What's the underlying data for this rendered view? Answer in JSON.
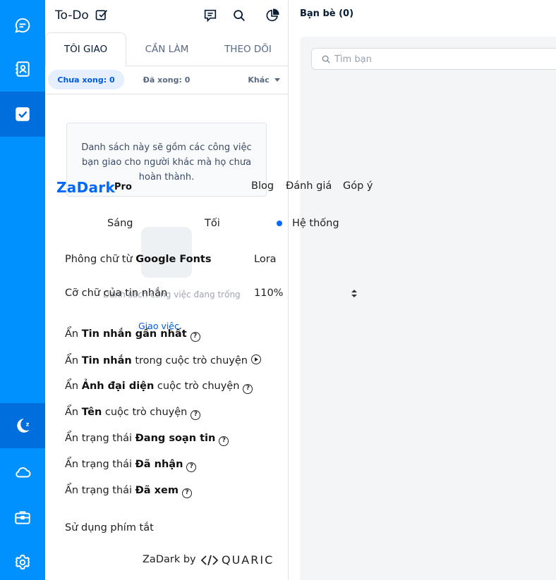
{
  "rail": {
    "top_icons": [
      "chat-icon",
      "contacts-icon",
      "todo-icon"
    ],
    "bottom_icons": [
      "zadark-icon",
      "cloud-icon",
      "briefcase-icon",
      "settings-icon"
    ],
    "accent": "#0091ff",
    "active_bg": "#006edc"
  },
  "todo": {
    "title": "To-Do",
    "tabs": [
      "TÔI GIAO",
      "CẦN LÀM",
      "THEO DÕI"
    ],
    "filters": [
      "Chưa xong: 0",
      "Đã xong: 0",
      "Khác"
    ],
    "empty_message": "Danh sách này sẽ gồm các công việc bạn giao cho người khác mà họ chưa hoàn thành.",
    "ghost_text": "Danh sách công việc đang trống",
    "ghost_link": "Giao việc"
  },
  "friends": {
    "title": "Bạn bè (0)",
    "search_placeholder": "Tìm bạn"
  },
  "zadark": {
    "brand": "ZaDark",
    "badge": "Pro",
    "nav": [
      "Blog",
      "Đánh giá",
      "Góp ý"
    ],
    "themes": [
      "Sáng",
      "Tối",
      "Hệ thống"
    ],
    "selected_theme": "Hệ thống",
    "font_label_prefix": "Phông chữ từ ",
    "font_label_strong": "Google Fonts",
    "font_value": "Lora",
    "size_label": "Cỡ chữ của tin nhắn",
    "size_value": "110%",
    "options": [
      {
        "prefix": "Ẩn ",
        "strong": "Tin nhắn gần nhất",
        "suffix": "",
        "icon": "help-icon"
      },
      {
        "prefix": "Ẩn ",
        "strong": "Tin nhắn",
        "suffix": " trong cuộc trò chuyện",
        "icon": "play-icon"
      },
      {
        "prefix": "Ẩn ",
        "strong": "Ảnh đại diện",
        "suffix": " cuộc trò chuyện",
        "icon": "help-icon"
      },
      {
        "prefix": "Ẩn ",
        "strong": "Tên",
        "suffix": " cuộc trò chuyện",
        "icon": "help-icon"
      },
      {
        "prefix": "Ẩn trạng thái ",
        "strong": "Đang soạn tin",
        "suffix": "",
        "icon": "help-icon"
      },
      {
        "prefix": "Ẩn trạng thái ",
        "strong": "Đã nhận",
        "suffix": "",
        "icon": "help-icon"
      },
      {
        "prefix": "Ẩn trạng thái ",
        "strong": "Đã xem",
        "suffix": "",
        "icon": "help-icon"
      }
    ],
    "shortcuts_label": "Sử dụng phím tắt",
    "footer_by": "ZaDark by",
    "footer_brand": "QUARIC"
  }
}
